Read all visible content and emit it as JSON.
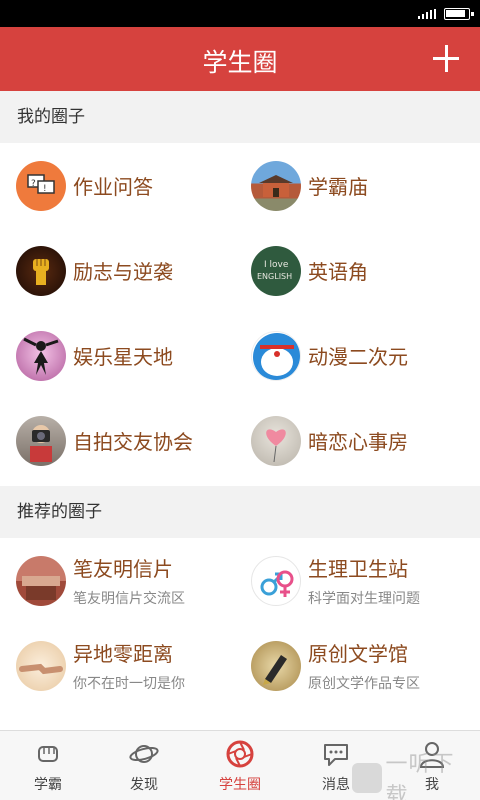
{
  "title": "学生圈",
  "sections": {
    "mine": {
      "header": "我的圈子",
      "items": [
        {
          "name": "作业问答",
          "icon": "qa-bubbles-icon"
        },
        {
          "name": "学霸庙",
          "icon": "temple-photo-icon"
        },
        {
          "name": "励志与逆袭",
          "icon": "raised-fist-icon"
        },
        {
          "name": "英语角",
          "icon": "i-love-english-chalkboard-icon"
        },
        {
          "name": "娱乐星天地",
          "icon": "dancer-silhouette-icon"
        },
        {
          "name": "动漫二次元",
          "icon": "doraemon-icon"
        },
        {
          "name": "自拍交友协会",
          "icon": "selfie-camera-icon"
        },
        {
          "name": "暗恋心事房",
          "icon": "heart-balloon-icon"
        }
      ]
    },
    "recommended": {
      "header": "推荐的圈子",
      "items": [
        {
          "name": "笔友明信片",
          "desc": "笔友明信片交流区",
          "icon": "postcard-photo-icon"
        },
        {
          "name": "生理卫生站",
          "desc": "科学面对生理问题",
          "icon": "gender-symbols-icon"
        },
        {
          "name": "异地零距离",
          "desc": "你不在时一切是你",
          "icon": "holding-hands-icon"
        },
        {
          "name": "原创文学馆",
          "desc": "原创文学作品专区",
          "icon": "fountain-pen-icon"
        }
      ]
    }
  },
  "tabs": [
    {
      "label": "学霸",
      "icon": "fist-icon"
    },
    {
      "label": "发现",
      "icon": "planet-icon"
    },
    {
      "label": "学生圈",
      "icon": "aperture-icon",
      "active": true
    },
    {
      "label": "消息",
      "icon": "chat-bubble-icon"
    },
    {
      "label": "我",
      "icon": "person-icon"
    }
  ],
  "watermark": "一听下载",
  "colors": {
    "accent": "#d6423e",
    "item_text": "#8c4a1f"
  }
}
